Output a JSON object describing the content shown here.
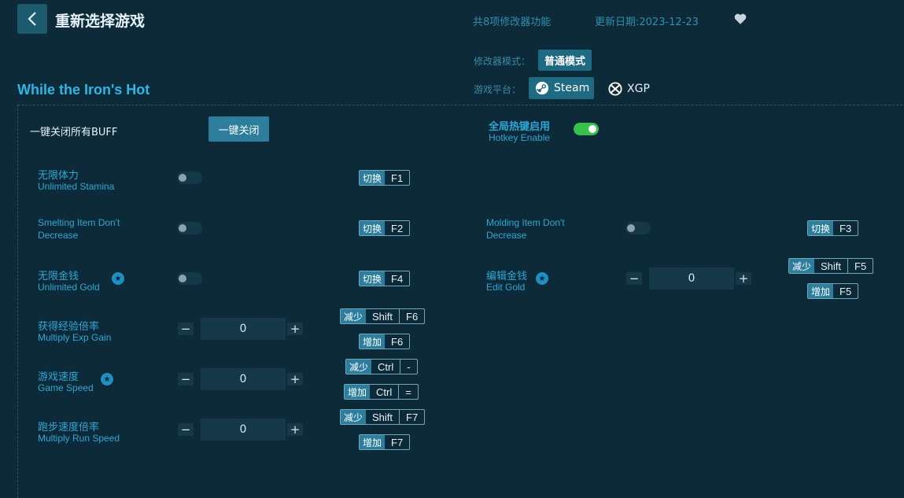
{
  "header": {
    "title": "重新选择游戏",
    "feature_count": "共8项修改器功能",
    "update_date": "更新日期:2023-12-23"
  },
  "mode": {
    "label": "修改器模式：",
    "value": "普通模式"
  },
  "platform": {
    "label": "游戏平台：",
    "steam": "Steam",
    "xgp": "XGP"
  },
  "game_title": "While the Iron's Hot",
  "global": {
    "close_all_label": "一键关闭所有BUFF",
    "close_all_button": "一键关闭",
    "hotkey_zh": "全局热键启用",
    "hotkey_en": "Hotkey Enable",
    "hotkey_enabled": true
  },
  "tags": {
    "toggle": "切换",
    "decrease": "减少",
    "increase": "增加"
  },
  "cheats": {
    "stamina": {
      "zh": "无限体力",
      "en": "Unlimited Stamina",
      "key": "F1",
      "enabled": false
    },
    "smelting": {
      "en1": "Smelting Item Don't",
      "en2": "Decrease",
      "key": "F2",
      "enabled": false
    },
    "molding": {
      "en1": "Molding Item Don't",
      "en2": "Decrease",
      "key": "F3",
      "enabled": false
    },
    "gold": {
      "zh": "无限金钱",
      "en": "Unlimited Gold",
      "key": "F4",
      "enabled": false
    },
    "edit_gold": {
      "zh": "编辑金钱",
      "en": "Edit Gold",
      "value": "0",
      "dec_mod": "Shift",
      "dec_key": "F5",
      "inc_key": "F5"
    },
    "exp": {
      "zh": "获得经验倍率",
      "en": "Multiply Exp Gain",
      "value": "0",
      "dec_mod": "Shift",
      "dec_key": "F6",
      "inc_key": "F6"
    },
    "speed": {
      "zh": "游戏速度",
      "en": "Game Speed",
      "value": "0",
      "dec_mod": "Ctrl",
      "dec_key": "-",
      "inc_mod": "Ctrl",
      "inc_key": "="
    },
    "run": {
      "zh": "跑步速度倍率",
      "en": "Multiply Run Speed",
      "value": "0",
      "dec_mod": "Shift",
      "dec_key": "F7",
      "inc_key": "F7"
    }
  },
  "colors": {
    "background": "#0d2a38",
    "accent": "#2c7e9c",
    "label": "#2fa7d6",
    "toggle_on": "#39c24a"
  }
}
